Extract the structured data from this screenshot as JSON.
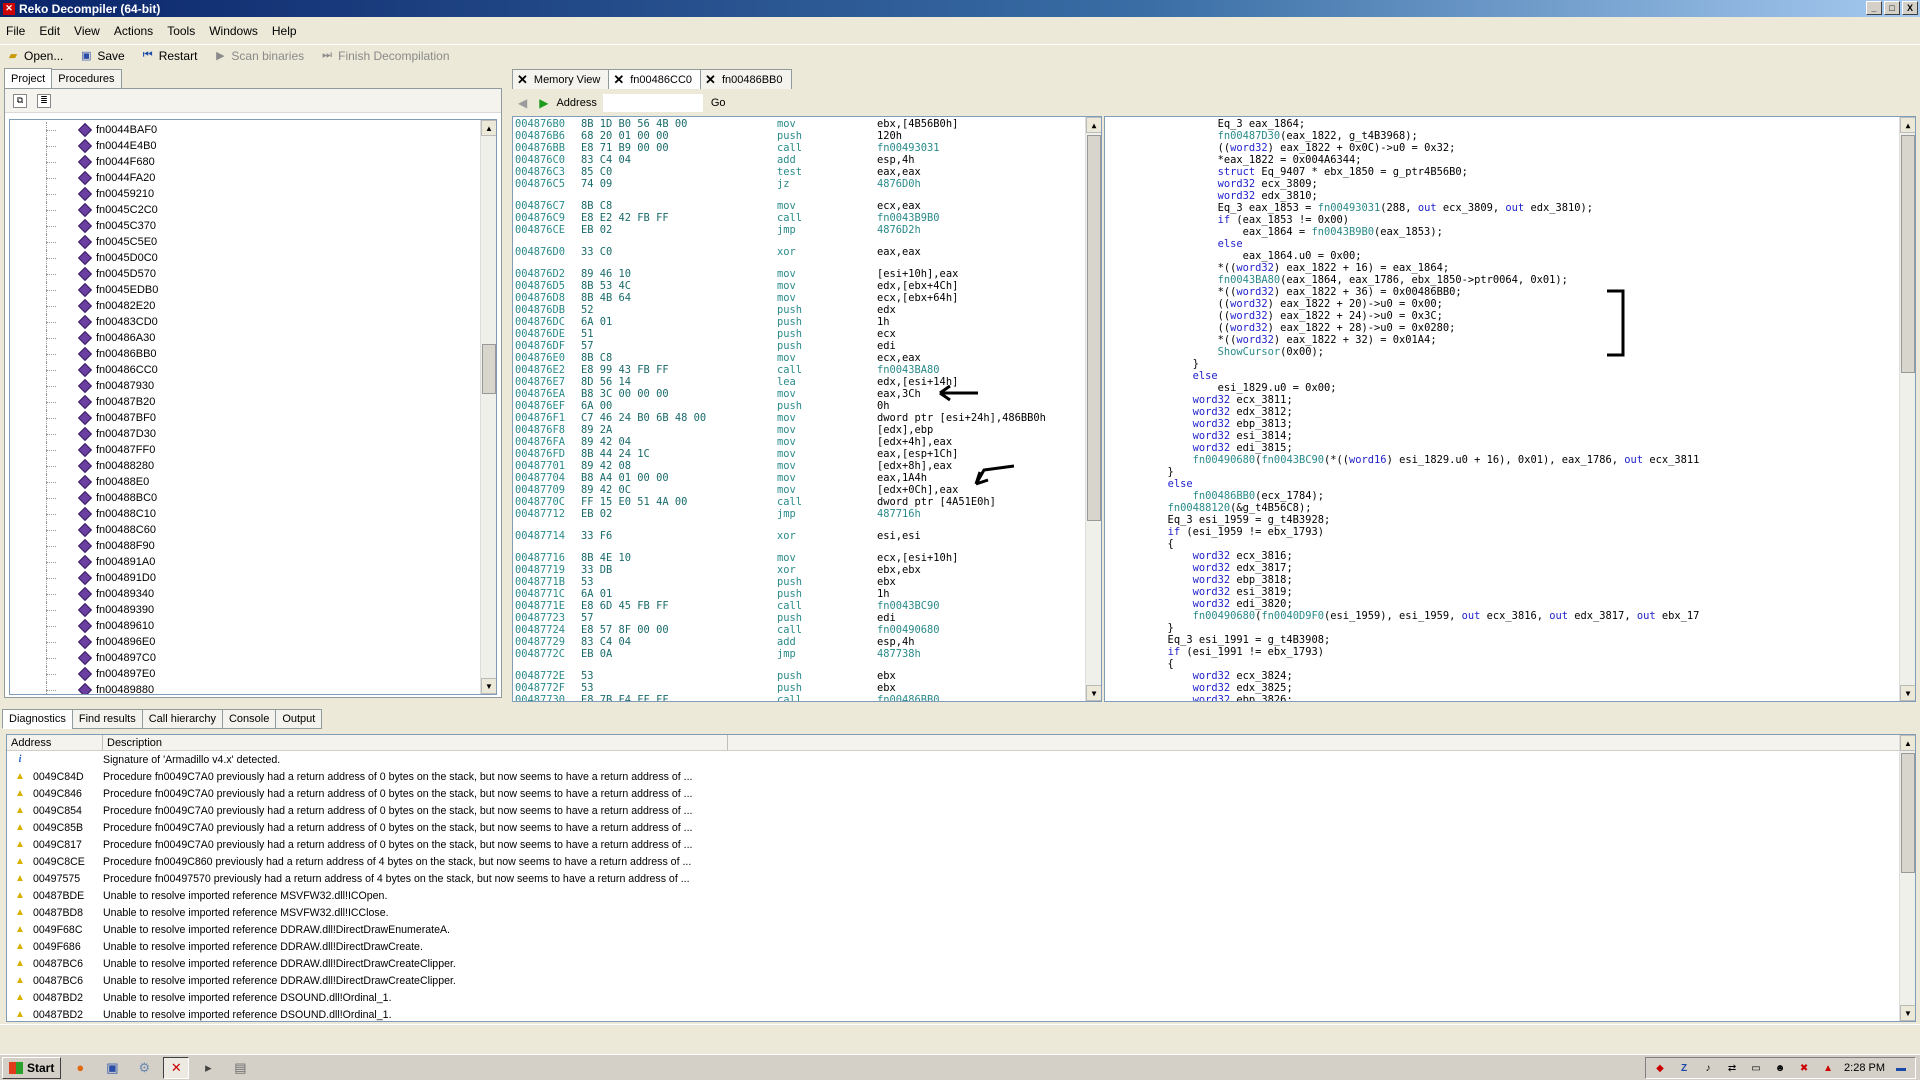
{
  "window": {
    "title": "Reko Decompiler (64-bit)",
    "app_icon": "reko-icon",
    "controls": [
      "_",
      "□",
      "X"
    ]
  },
  "menu": [
    "File",
    "Edit",
    "View",
    "Actions",
    "Tools",
    "Windows",
    "Help"
  ],
  "toolbar": {
    "open": "Open...",
    "save": "Save",
    "restart": "Restart",
    "scan": "Scan binaries",
    "finish": "Finish Decompilation"
  },
  "left_tabs": [
    "Project",
    "Procedures"
  ],
  "procedures": [
    "fn0044BAF0",
    "fn0044E4B0",
    "fn0044F680",
    "fn0044FA20",
    "fn00459210",
    "fn0045C2C0",
    "fn0045C370",
    "fn0045C5E0",
    "fn0045D0C0",
    "fn0045D570",
    "fn0045EDB0",
    "fn00482E20",
    "fn00483CD0",
    "fn00486A30",
    "fn00486BB0",
    "fn00486CC0",
    "fn00487930",
    "fn00487B20",
    "fn00487BF0",
    "fn00487D30",
    "fn00487FF0",
    "fn00488280",
    "fn00488E0",
    "fn00488BC0",
    "fn00488C10",
    "fn00488C60",
    "fn00488F90",
    "fn004891A0",
    "fn004891D0",
    "fn00489340",
    "fn00489390",
    "fn00489610",
    "fn004896E0",
    "fn004897C0",
    "fn004897E0",
    "fn00489880"
  ],
  "doc_tabs": [
    "Memory View",
    "fn00486CC0",
    "fn00486BB0"
  ],
  "address_bar": {
    "label": "Address",
    "go": "Go"
  },
  "disassembly": [
    {
      "addr": "004876B0",
      "bytes": "8B 1D B0 56 4B 00",
      "mn": "mov",
      "op": "ebx,[4B56B0h]"
    },
    {
      "addr": "004876B6",
      "bytes": "68 20 01 00 00",
      "mn": "push",
      "op": "120h"
    },
    {
      "addr": "004876BB",
      "bytes": "E8 71 B9 00 00",
      "mn": "call",
      "op": "fn00493031"
    },
    {
      "addr": "004876C0",
      "bytes": "83 C4 04",
      "mn": "add",
      "op": "esp,4h"
    },
    {
      "addr": "004876C3",
      "bytes": "85 C0",
      "mn": "test",
      "op": "eax,eax"
    },
    {
      "addr": "004876C5",
      "bytes": "74 09",
      "mn": "jz",
      "op": "4876D0h"
    },
    {
      "gap": true
    },
    {
      "addr": "004876C7",
      "bytes": "8B C8",
      "mn": "mov",
      "op": "ecx,eax"
    },
    {
      "addr": "004876C9",
      "bytes": "E8 E2 42 FB FF",
      "mn": "call",
      "op": "fn0043B9B0"
    },
    {
      "addr": "004876CE",
      "bytes": "EB 02",
      "mn": "jmp",
      "op": "4876D2h"
    },
    {
      "gap": true
    },
    {
      "addr": "004876D0",
      "bytes": "33 C0",
      "mn": "xor",
      "op": "eax,eax"
    },
    {
      "gap": true
    },
    {
      "addr": "004876D2",
      "bytes": "89 46 10",
      "mn": "mov",
      "op": "[esi+10h],eax"
    },
    {
      "addr": "004876D5",
      "bytes": "8B 53 4C",
      "mn": "mov",
      "op": "edx,[ebx+4Ch]"
    },
    {
      "addr": "004876D8",
      "bytes": "8B 4B 64",
      "mn": "mov",
      "op": "ecx,[ebx+64h]"
    },
    {
      "addr": "004876DB",
      "bytes": "52",
      "mn": "push",
      "op": "edx"
    },
    {
      "addr": "004876DC",
      "bytes": "6A 01",
      "mn": "push",
      "op": "1h"
    },
    {
      "addr": "004876DE",
      "bytes": "51",
      "mn": "push",
      "op": "ecx"
    },
    {
      "addr": "004876DF",
      "bytes": "57",
      "mn": "push",
      "op": "edi"
    },
    {
      "addr": "004876E0",
      "bytes": "8B C8",
      "mn": "mov",
      "op": "ecx,eax"
    },
    {
      "addr": "004876E2",
      "bytes": "E8 99 43 FB FF",
      "mn": "call",
      "op": "fn0043BA80"
    },
    {
      "addr": "004876E7",
      "bytes": "8D 56 14",
      "mn": "lea",
      "op": "edx,[esi+14h]"
    },
    {
      "addr": "004876EA",
      "bytes": "B8 3C 00 00 00",
      "mn": "mov",
      "op": "eax,3Ch"
    },
    {
      "addr": "004876EF",
      "bytes": "6A 00",
      "mn": "push",
      "op": "0h"
    },
    {
      "addr": "004876F1",
      "bytes": "C7 46 24 B0 6B 48 00",
      "mn": "mov",
      "op": "dword ptr [esi+24h],486BB0h"
    },
    {
      "addr": "004876F8",
      "bytes": "89 2A",
      "mn": "mov",
      "op": "[edx],ebp"
    },
    {
      "addr": "004876FA",
      "bytes": "89 42 04",
      "mn": "mov",
      "op": "[edx+4h],eax"
    },
    {
      "addr": "004876FD",
      "bytes": "8B 44 24 1C",
      "mn": "mov",
      "op": "eax,[esp+1Ch]"
    },
    {
      "addr": "00487701",
      "bytes": "89 42 08",
      "mn": "mov",
      "op": "[edx+8h],eax"
    },
    {
      "addr": "00487704",
      "bytes": "B8 A4 01 00 00",
      "mn": "mov",
      "op": "eax,1A4h"
    },
    {
      "addr": "00487709",
      "bytes": "89 42 0C",
      "mn": "mov",
      "op": "[edx+0Ch],eax"
    },
    {
      "addr": "0048770C",
      "bytes": "FF 15 E0 51 4A 00",
      "mn": "call",
      "op": "dword ptr [4A51E0h]"
    },
    {
      "addr": "00487712",
      "bytes": "EB 02",
      "mn": "jmp",
      "op": "487716h"
    },
    {
      "gap": true
    },
    {
      "addr": "00487714",
      "bytes": "33 F6",
      "mn": "xor",
      "op": "esi,esi"
    },
    {
      "gap": true
    },
    {
      "addr": "00487716",
      "bytes": "8B 4E 10",
      "mn": "mov",
      "op": "ecx,[esi+10h]"
    },
    {
      "addr": "00487719",
      "bytes": "33 DB",
      "mn": "xor",
      "op": "ebx,ebx"
    },
    {
      "addr": "0048771B",
      "bytes": "53",
      "mn": "push",
      "op": "ebx"
    },
    {
      "addr": "0048771C",
      "bytes": "6A 01",
      "mn": "push",
      "op": "1h"
    },
    {
      "addr": "0048771E",
      "bytes": "E8 6D 45 FB FF",
      "mn": "call",
      "op": "fn0043BC90"
    },
    {
      "addr": "00487723",
      "bytes": "57",
      "mn": "push",
      "op": "edi"
    },
    {
      "addr": "00487724",
      "bytes": "E8 57 8F 00 00",
      "mn": "call",
      "op": "fn00490680"
    },
    {
      "addr": "00487729",
      "bytes": "83 C4 04",
      "mn": "add",
      "op": "esp,4h"
    },
    {
      "addr": "0048772C",
      "bytes": "EB 0A",
      "mn": "jmp",
      "op": "487738h"
    },
    {
      "gap": true
    },
    {
      "addr": "0048772E",
      "bytes": "53",
      "mn": "push",
      "op": "ebx"
    },
    {
      "addr": "0048772F",
      "bytes": "53",
      "mn": "push",
      "op": "ebx"
    },
    {
      "addr": "00487730",
      "bytes": "E8 7B F4 FF FF",
      "mn": "call",
      "op": "fn00486BB0"
    }
  ],
  "code": [
    "                  Eq_3 eax_1864;",
    "                  fn00487D30(eax_1822, g_t4B3968);",
    "                  ((word32) eax_1822 + 0x0C)->u0 = 0x32;",
    "                  *eax_1822 = 0x004A6344;",
    "                  struct Eq_9407 * ebx_1850 = g_ptr4B56B0;",
    "                  word32 ecx_3809;",
    "                  word32 edx_3810;",
    "                  Eq_3 eax_1853 = fn00493031(288, out ecx_3809, out edx_3810);",
    "                  if (eax_1853 != 0x00)",
    "                      eax_1864 = fn0043B9B0(eax_1853);",
    "                  else",
    "                      eax_1864.u0 = 0x00;",
    "                  *((word32) eax_1822 + 16) = eax_1864;",
    "                  fn0043BA80(eax_1864, eax_1786, ebx_1850->ptr0064, 0x01);",
    "                  *((word32) eax_1822 + 36) = 0x00486BB0;",
    "                  ((word32) eax_1822 + 20)->u0 = 0x00;",
    "                  ((word32) eax_1822 + 24)->u0 = 0x3C;",
    "                  ((word32) eax_1822 + 28)->u0 = 0x0280;",
    "                  *((word32) eax_1822 + 32) = 0x01A4;",
    "                  ShowCursor(0x00);",
    "              }",
    "              else",
    "                  esi_1829.u0 = 0x00;",
    "              word32 ecx_3811;",
    "              word32 edx_3812;",
    "              word32 ebp_3813;",
    "              word32 esi_3814;",
    "              word32 edi_3815;",
    "              fn00490680(fn0043BC90(*((word16) esi_1829.u0 + 16), 0x01), eax_1786, out ecx_3811",
    "          }",
    "          else",
    "              fn00486BB0(ecx_1784);",
    "          fn00488120(&g_t4B56C8);",
    "          Eq_3 esi_1959 = g_t4B3928;",
    "          if (esi_1959 != ebx_1793)",
    "          {",
    "              word32 ecx_3816;",
    "              word32 edx_3817;",
    "              word32 ebp_3818;",
    "              word32 esi_3819;",
    "              word32 edi_3820;",
    "              fn00490680(fn0040D9F0(esi_1959), esi_1959, out ecx_3816, out edx_3817, out ebx_17",
    "          }",
    "          Eq_3 esi_1991 = g_t4B3908;",
    "          if (esi_1991 != ebx_1793)",
    "          {",
    "              word32 ecx_3824;",
    "              word32 edx_3825;",
    "              word32 ebp_3826;"
  ],
  "bottom_tabs": [
    "Diagnostics",
    "Find results",
    "Call hierarchy",
    "Console",
    "Output"
  ],
  "diagnostics": {
    "columns": [
      "Address",
      "Description"
    ],
    "rows": [
      {
        "type": "info",
        "addr": "",
        "desc": "Signature of 'Armadillo v4.x' detected."
      },
      {
        "type": "warn",
        "addr": "0049C84D",
        "desc": "Procedure fn0049C7A0 previously had a return address of 0 bytes on the stack, but now seems to have a return address of ..."
      },
      {
        "type": "warn",
        "addr": "0049C846",
        "desc": "Procedure fn0049C7A0 previously had a return address of 0 bytes on the stack, but now seems to have a return address of ..."
      },
      {
        "type": "warn",
        "addr": "0049C854",
        "desc": "Procedure fn0049C7A0 previously had a return address of 0 bytes on the stack, but now seems to have a return address of ..."
      },
      {
        "type": "warn",
        "addr": "0049C85B",
        "desc": "Procedure fn0049C7A0 previously had a return address of 0 bytes on the stack, but now seems to have a return address of ..."
      },
      {
        "type": "warn",
        "addr": "0049C817",
        "desc": "Procedure fn0049C7A0 previously had a return address of 0 bytes on the stack, but now seems to have a return address of ..."
      },
      {
        "type": "warn",
        "addr": "0049C8CE",
        "desc": "Procedure fn0049C860 previously had a return address of 4 bytes on the stack, but now seems to have a return address of ..."
      },
      {
        "type": "warn",
        "addr": "00497575",
        "desc": "Procedure fn00497570 previously had a return address of 4 bytes on the stack, but now seems to have a return address of ..."
      },
      {
        "type": "warn",
        "addr": "00487BDE",
        "desc": "Unable to resolve imported reference MSVFW32.dll!ICOpen."
      },
      {
        "type": "warn",
        "addr": "00487BD8",
        "desc": "Unable to resolve imported reference MSVFW32.dll!ICClose."
      },
      {
        "type": "warn",
        "addr": "0049F68C",
        "desc": "Unable to resolve imported reference DDRAW.dll!DirectDrawEnumerateA."
      },
      {
        "type": "warn",
        "addr": "0049F686",
        "desc": "Unable to resolve imported reference DDRAW.dll!DirectDrawCreate."
      },
      {
        "type": "warn",
        "addr": "00487BC6",
        "desc": "Unable to resolve imported reference DDRAW.dll!DirectDrawCreateClipper."
      },
      {
        "type": "warn",
        "addr": "00487BC6",
        "desc": "Unable to resolve imported reference DDRAW.dll!DirectDrawCreateClipper."
      },
      {
        "type": "warn",
        "addr": "00487BD2",
        "desc": "Unable to resolve imported reference DSOUND.dll!Ordinal_1."
      },
      {
        "type": "warn",
        "addr": "00487BD2",
        "desc": "Unable to resolve imported reference DSOUND.dll!Ordinal_1."
      }
    ]
  },
  "taskbar": {
    "start": "Start",
    "clock": "2:28 PM"
  }
}
